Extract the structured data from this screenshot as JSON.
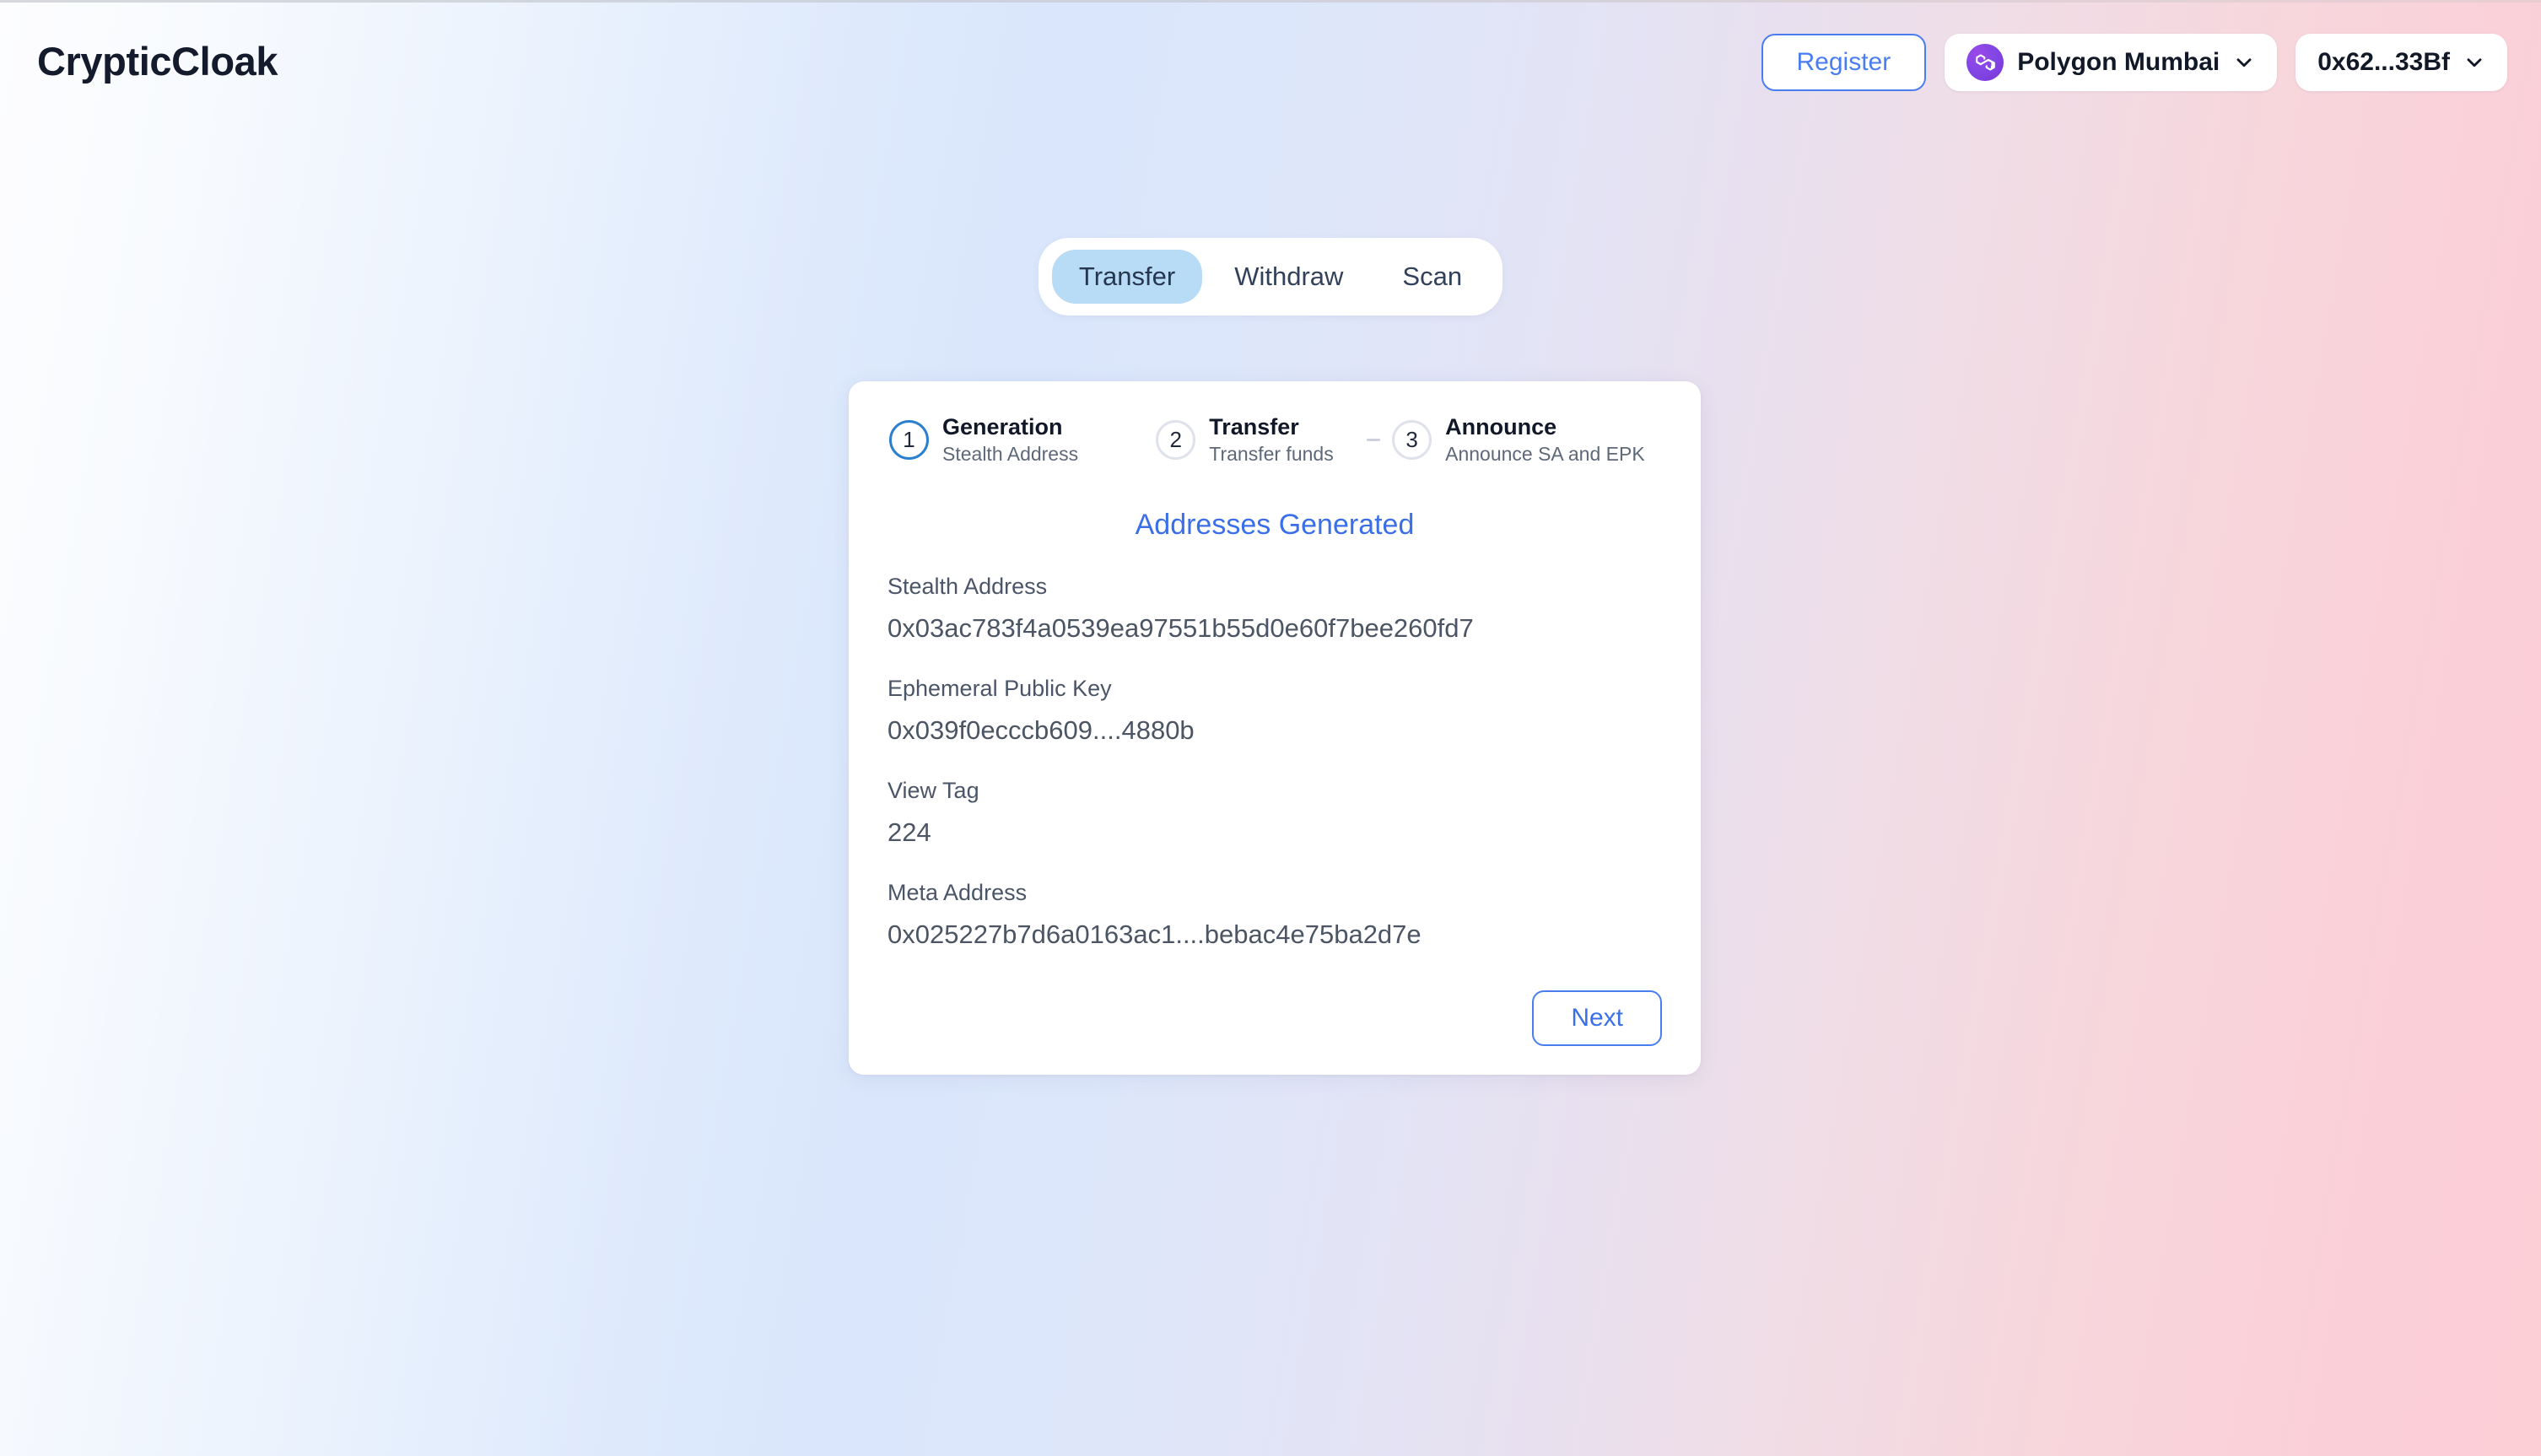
{
  "brand": {
    "name": "CrypticCloak"
  },
  "header": {
    "register_label": "Register",
    "network": {
      "name": "Polygon Mumbai",
      "icon": "polygon-logo-icon",
      "color": "#8247e5"
    },
    "wallet": {
      "address": "0x62...33Bf"
    },
    "chevron_icon": "chevron-down-icon"
  },
  "tabs": {
    "items": [
      {
        "label": "Transfer",
        "active": true
      },
      {
        "label": "Withdraw",
        "active": false
      },
      {
        "label": "Scan",
        "active": false
      }
    ]
  },
  "stepper": {
    "steps": [
      {
        "number": "1",
        "title": "Generation",
        "subtitle": "Stealth Address",
        "active": true
      },
      {
        "number": "2",
        "title": "Transfer",
        "subtitle": "Transfer funds",
        "active": false
      },
      {
        "number": "3",
        "title": "Announce",
        "subtitle": "Announce SA and EPK",
        "active": false
      }
    ]
  },
  "card": {
    "status": "Addresses Generated",
    "fields": [
      {
        "label": "Stealth Address",
        "value": "0x03ac783f4a0539ea97551b55d0e60f7bee260fd7"
      },
      {
        "label": "Ephemeral Public Key",
        "value": "0x039f0ecccb609....4880b"
      },
      {
        "label": "View Tag",
        "value": "224"
      },
      {
        "label": "Meta Address",
        "value": "0x025227b7d6a0163ac1....bebac4e75ba2d7e"
      }
    ],
    "next_label": "Next"
  },
  "colors": {
    "accent_blue": "#4a7ef0",
    "status_blue": "#3b6fe8",
    "tab_active_bg": "#b9dcf6",
    "step_active": "#2b7fce",
    "polygon_purple": "#8247e5"
  }
}
